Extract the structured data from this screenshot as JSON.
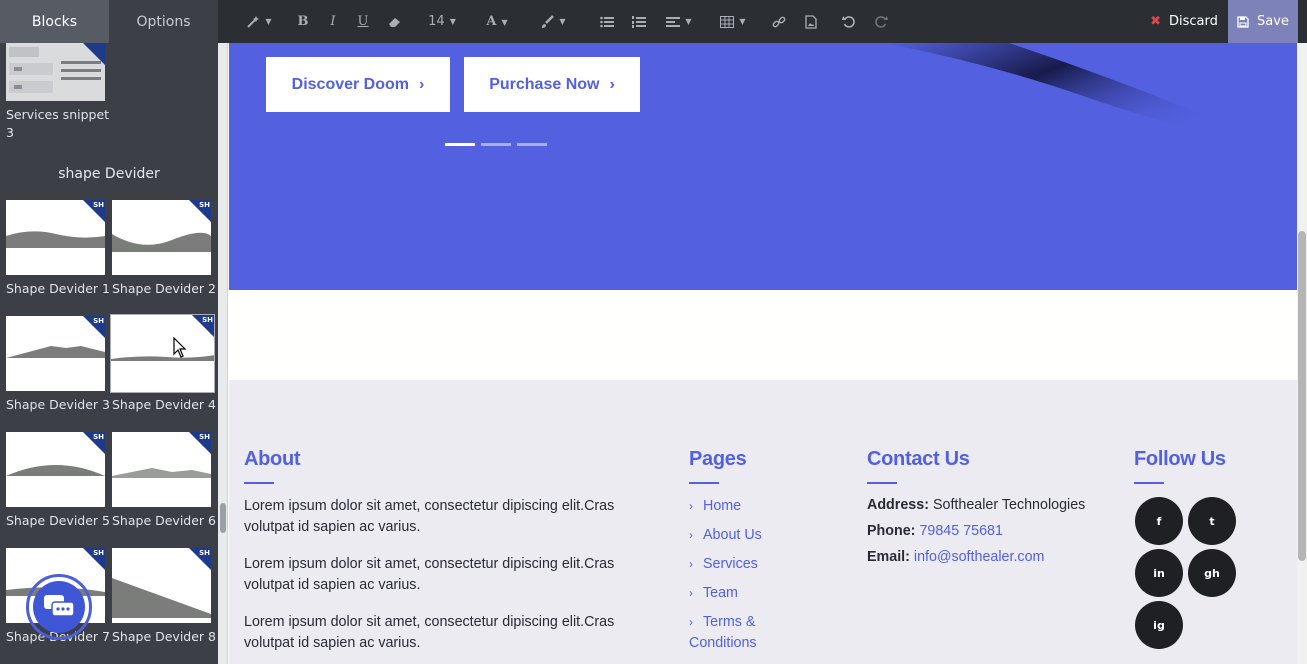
{
  "sidebar": {
    "tabs": [
      {
        "label": "Blocks",
        "active": true
      },
      {
        "label": "Options",
        "active": false
      }
    ],
    "top_snippet_label": "Services snippet 3",
    "section_title": "shape Devider",
    "badge": "SH",
    "snippets": [
      "Shape Devider 1",
      "Shape Devider 2",
      "Shape Devider 3",
      "Shape Devider 4",
      "Shape Devider 5",
      "Shape Devider 6",
      "Shape Devider 7",
      "Shape Devider 8"
    ]
  },
  "toolbar": {
    "font_size": "14",
    "discard_label": "Discard",
    "save_label": "Save",
    "icons": [
      "magic-wand-icon",
      "bold-icon",
      "italic-icon",
      "underline-icon",
      "eraser-icon",
      "font-size",
      "font-color-icon",
      "paintbrush-icon",
      "unordered-list-icon",
      "ordered-list-icon",
      "align-icon",
      "table-icon",
      "link-icon",
      "image-icon",
      "undo-icon",
      "redo-icon"
    ]
  },
  "hero": {
    "buttons": [
      {
        "label": "Discover Doom",
        "chevron": "›"
      },
      {
        "label": "Purchase Now",
        "chevron": "›"
      }
    ]
  },
  "footer": {
    "about": {
      "title": "About",
      "paragraphs": [
        "Lorem ipsum dolor sit amet, consectetur dipiscing elit.Cras volutpat id sapien ac varius.",
        "Lorem ipsum dolor sit amet, consectetur dipiscing elit.Cras volutpat id sapien ac varius.",
        "Lorem ipsum dolor sit amet, consectetur dipiscing elit.Cras volutpat id sapien ac varius."
      ]
    },
    "pages": {
      "title": "Pages",
      "links": [
        "Home",
        "About Us",
        "Services",
        "Team",
        "Terms & Conditions"
      ]
    },
    "contact": {
      "title": "Contact Us",
      "address_label": "Address:",
      "address": "Softhealer Technologies",
      "phone_label": "Phone:",
      "phone": "79845 75681",
      "email_label": "Email:",
      "email": "info@softhealer.com"
    },
    "follow": {
      "title": "Follow Us",
      "networks": [
        "facebook",
        "twitter",
        "linkedin",
        "github",
        "instagram"
      ],
      "glyphs": [
        "f",
        "t",
        "in",
        "gh",
        "ig"
      ]
    }
  },
  "colors": {
    "accent": "#5360e0",
    "sidebar_bg": "#3c3f45",
    "toolbar_bg": "#2b2e33",
    "footer_bg": "#ebebf1",
    "discard_x": "#e0454f",
    "save_bg": "#7d83b8"
  }
}
